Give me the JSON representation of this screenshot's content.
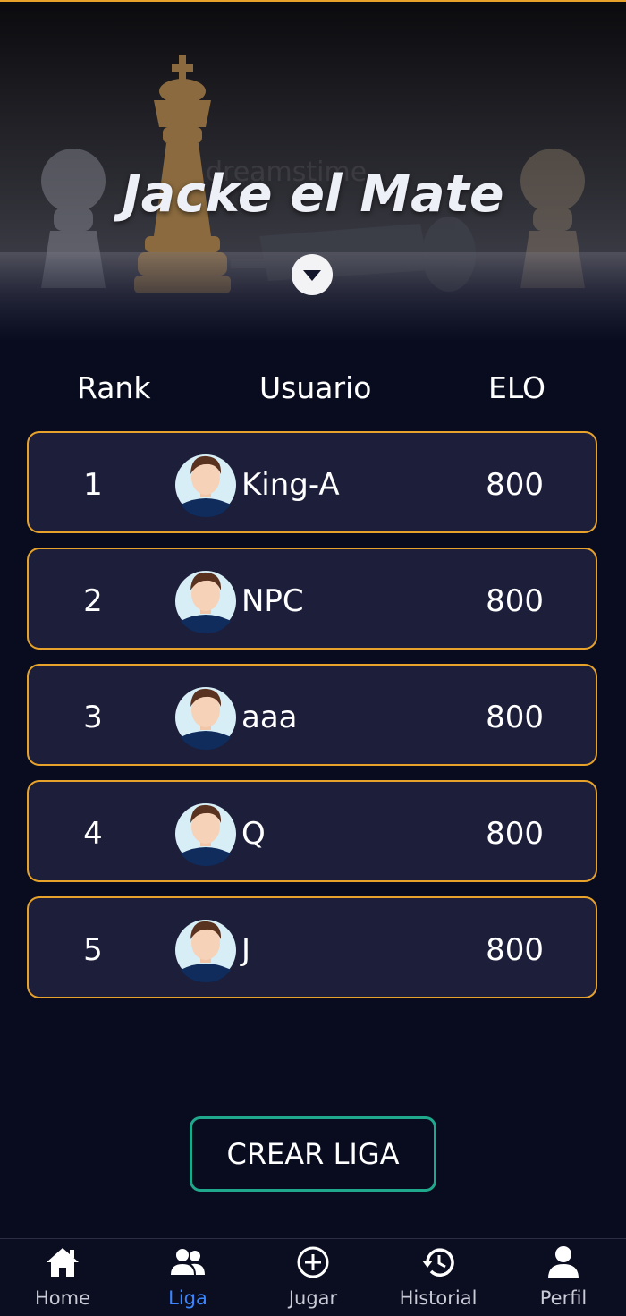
{
  "header": {
    "league_title": "Jacke el Mate"
  },
  "table": {
    "columns": [
      "Rank",
      "Usuario",
      "ELO"
    ],
    "rows": [
      {
        "rank": "1",
        "user": "King-A",
        "elo": "800"
      },
      {
        "rank": "2",
        "user": "NPC",
        "elo": "800"
      },
      {
        "rank": "3",
        "user": "aaa",
        "elo": "800"
      },
      {
        "rank": "4",
        "user": "Q",
        "elo": "800"
      },
      {
        "rank": "5",
        "user": "J",
        "elo": "800"
      }
    ]
  },
  "actions": {
    "create_league_label": "CREAR LIGA"
  },
  "nav": {
    "items": [
      {
        "label": "Home",
        "icon": "home-icon"
      },
      {
        "label": "Liga",
        "icon": "group-icon",
        "active": true
      },
      {
        "label": "Jugar",
        "icon": "add-circle-icon"
      },
      {
        "label": "Historial",
        "icon": "history-icon"
      },
      {
        "label": "Perfil",
        "icon": "person-icon"
      }
    ]
  },
  "colors": {
    "background": "#090c1f",
    "row_background": "#1c1e3a",
    "row_border": "#e6a22a",
    "button_border": "#1fa88b",
    "nav_active": "#3a86ff"
  }
}
